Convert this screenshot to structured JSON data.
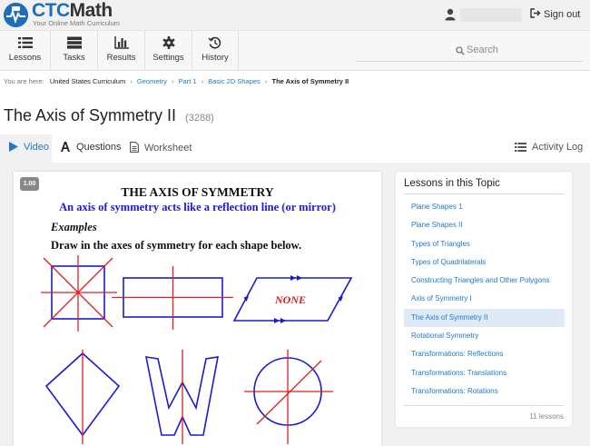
{
  "brand": {
    "name_part1": "CTC",
    "name_part2": "Math",
    "tagline": "Your Online Math Curriculum",
    "primary_color": "#1f6fb8"
  },
  "header": {
    "user_icon": "user-icon",
    "signout_label": "Sign out",
    "signout_icon": "sign-out-icon"
  },
  "nav": {
    "items": [
      {
        "label": "Lessons",
        "icon": "list-icon"
      },
      {
        "label": "Tasks",
        "icon": "tasks-icon"
      },
      {
        "label": "Results",
        "icon": "bar-chart-icon"
      },
      {
        "label": "Settings",
        "icon": "gear-icon"
      },
      {
        "label": "History",
        "icon": "history-icon"
      }
    ],
    "search_placeholder": "Search"
  },
  "breadcrumb": {
    "prefix": "You are here:",
    "root": "United States Curriculum",
    "links": [
      "Geometry",
      "Part 1",
      "Basic 2D Shapes"
    ],
    "current": "The Axis of Symmetry II"
  },
  "page": {
    "title": "The Axis of Symmetry II",
    "lesson_id": "(3288)"
  },
  "tabs": {
    "video": "Video",
    "questions": "Questions",
    "worksheet": "Worksheet",
    "activity_log": "Activity Log",
    "active": "video"
  },
  "video": {
    "timestamp": "1.00",
    "slide_title": "THE AXIS OF SYMMETRY",
    "slide_subtitle": "An axis of symmetry acts like a reflection line (or mirror)",
    "examples_label": "Examples",
    "instruction": "Draw in the axes of symmetry for each shape below.",
    "none_label": "NONE",
    "shape_color": "#1a1ad0",
    "axis_color": "#e02020"
  },
  "lessons_panel": {
    "heading": "Lessons in this Topic",
    "items": [
      "Plane Shapes 1",
      "Plane Shapes II",
      "Types of Triangles",
      "Types of Quadrilaterals",
      "Constructing Triangles and Other Polygons",
      "Axis of Symmetry I",
      "The Axis of Symmetry II",
      "Rotational Symmetry",
      "Transformations: Reflections",
      "Transformations: Translations",
      "Transformations: Rotations"
    ],
    "active_index": 6,
    "count_label": "11 lessons"
  }
}
